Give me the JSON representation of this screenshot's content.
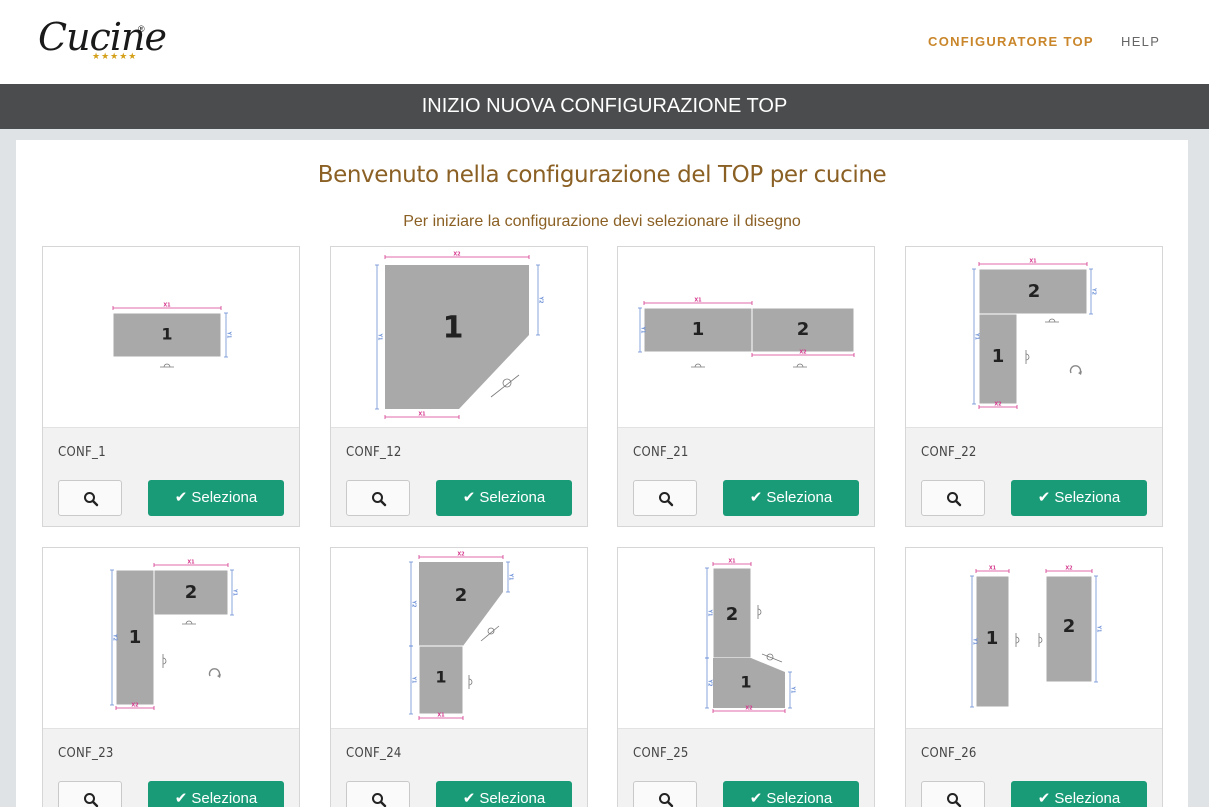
{
  "header": {
    "logo_text": "Cucine",
    "logo_reg": "®",
    "logo_stars": "★★★★★",
    "nav": [
      "CONFIGURATORE TOP",
      "HELP"
    ]
  },
  "banner": {
    "title": "INIZIO NUOVA CONFIGURAZIONE TOP"
  },
  "main": {
    "title": "Benvenuto nella configurazione del TOP per cucine",
    "subtitle": "Per iniziare la configurazione devi selezionare il disegno",
    "select_label": "Seleziona",
    "check_glyph": "✔",
    "cards": [
      {
        "name": "CONF_1"
      },
      {
        "name": "CONF_12"
      },
      {
        "name": "CONF_21"
      },
      {
        "name": "CONF_22"
      },
      {
        "name": "CONF_23"
      },
      {
        "name": "CONF_24"
      },
      {
        "name": "CONF_25"
      },
      {
        "name": "CONF_26"
      }
    ]
  },
  "diagram_labels": {
    "piece_1": "1",
    "piece_2": "2",
    "x1": "X1",
    "x2": "X2",
    "y1": "Y1",
    "y2": "Y2"
  },
  "icons": {
    "zoom": "search-icon",
    "check": "check-icon",
    "logo": "chef-logo"
  },
  "colors": {
    "accent": "#c9862a",
    "title": "#8b6024",
    "button": "#1a9b78",
    "banner": "#4b4c4d",
    "piece": "#a9a9a9"
  }
}
